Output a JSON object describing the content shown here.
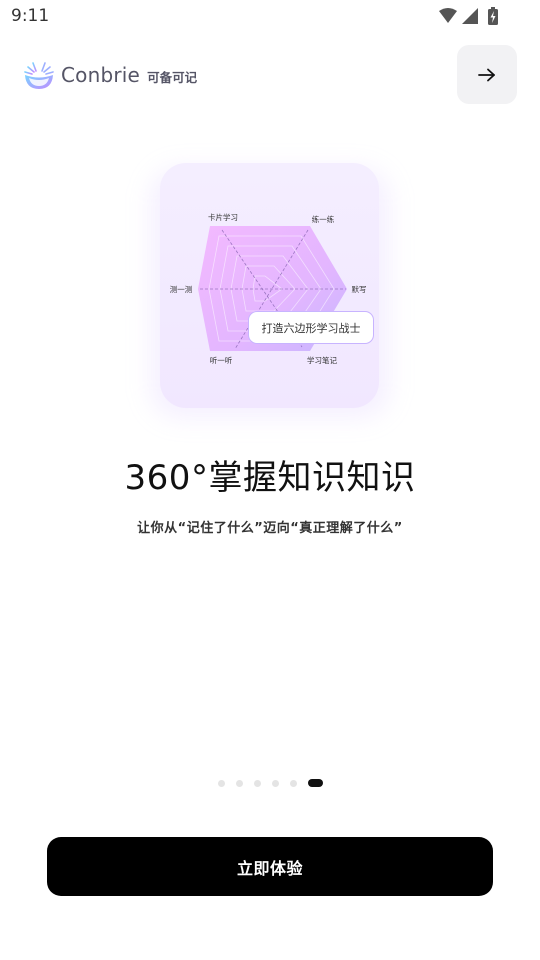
{
  "status_bar": {
    "time": "9:11",
    "icons": [
      "wifi-icon",
      "signal-icon",
      "battery-charging-icon"
    ]
  },
  "header": {
    "brand_en": "Conbrie",
    "brand_cn": "可备可记",
    "logo_icon": "sunrise-logo-icon",
    "next_icon": "arrow-right-icon"
  },
  "illustration": {
    "labels": {
      "top_left": "卡片学习",
      "top_right": "练一练",
      "left": "测一测",
      "right": "默写",
      "bottom_left": "听一听",
      "bottom_right": "学习笔记"
    },
    "chip": "打造六边形学习战士"
  },
  "content": {
    "headline": "360°掌握知识知识",
    "subline": "让你从“记住了什么”迈向“真正理解了什么”"
  },
  "pager": {
    "total": 6,
    "active_index": 5
  },
  "cta": {
    "label": "立即体验"
  },
  "colors": {
    "accent": "#c8b4ff",
    "card_bg": "#f4eeff",
    "cta_bg": "#000000",
    "next_button_bg": "#f2f2f4"
  }
}
